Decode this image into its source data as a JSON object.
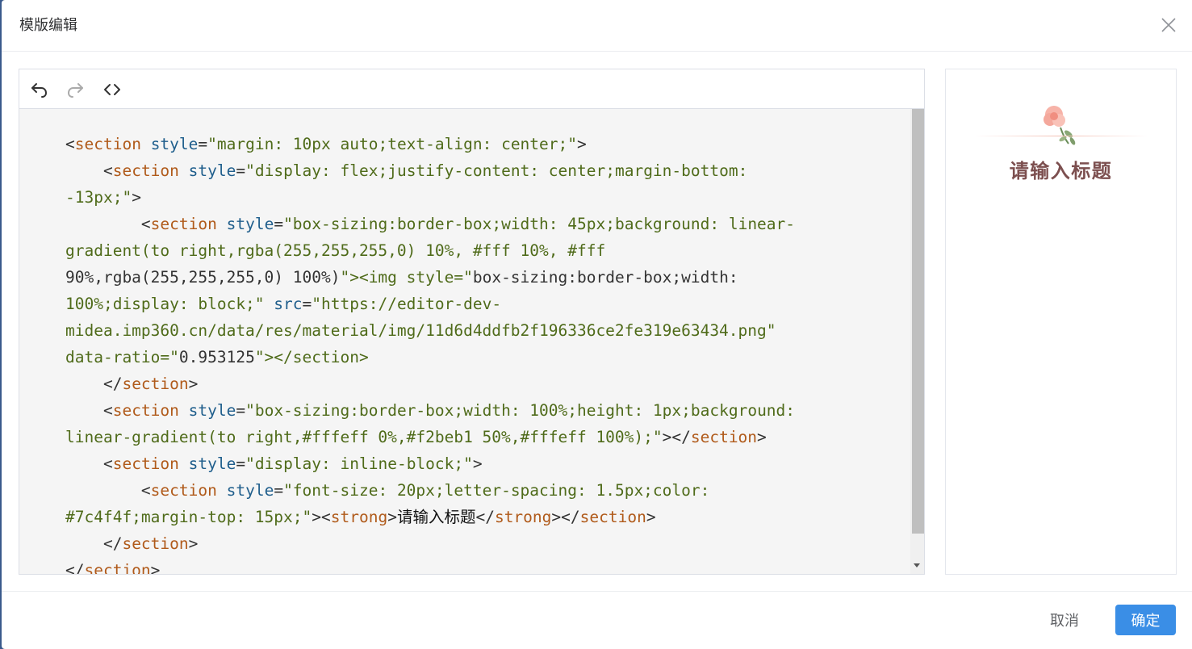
{
  "dialog": {
    "title": "模版编辑",
    "close_icon": "close-icon"
  },
  "toolbar": {
    "icons": [
      "undo-icon",
      "redo-icon",
      "code-icon"
    ]
  },
  "code": {
    "lines": [
      "<section style=\"margin: 10px auto;text-align: center;\">",
      "    <section style=\"display: flex;justify-content: center;margin-bottom:",
      "-13px;\">",
      "        <section style=\"box-sizing:border-box;width: 45px;background: linear-",
      "gradient(to right,rgba(255,255,255,0) 10%, #fff 10%, #fff",
      "90%,rgba(255,255,255,0) 100%)\"><img style=\"box-sizing:border-box;width:",
      "100%;display: block;\" src=\"https://editor-dev-",
      "midea.imp360.cn/data/res/material/img/11d6d4ddfb2f196336ce2fe319e63434.png\"",
      "data-ratio=\"0.953125\"></section>",
      "    </section>",
      "    <section style=\"box-sizing:border-box;width: 100%;height: 1px;background:",
      "linear-gradient(to right,#fffeff 0%,#f2beb1 50%,#fffeff 100%);\"></section>",
      "    <section style=\"display: inline-block;\">",
      "        <section style=\"font-size: 20px;letter-spacing: 1.5px;color:",
      "#7c4f4f;margin-top: 15px;\"><strong>请输入标题</strong></section>",
      "    </section>",
      "</section>"
    ]
  },
  "preview": {
    "title": "请输入标题",
    "title_color": "#7c4f4f",
    "line_gradient_color": "#f2beb1"
  },
  "footer": {
    "cancel_label": "取消",
    "ok_label": "确定"
  },
  "colors": {
    "primary": "#3a8ee6",
    "tag": "#b05a1a",
    "attr": "#1f5e8c",
    "value": "#4f6b1a"
  }
}
